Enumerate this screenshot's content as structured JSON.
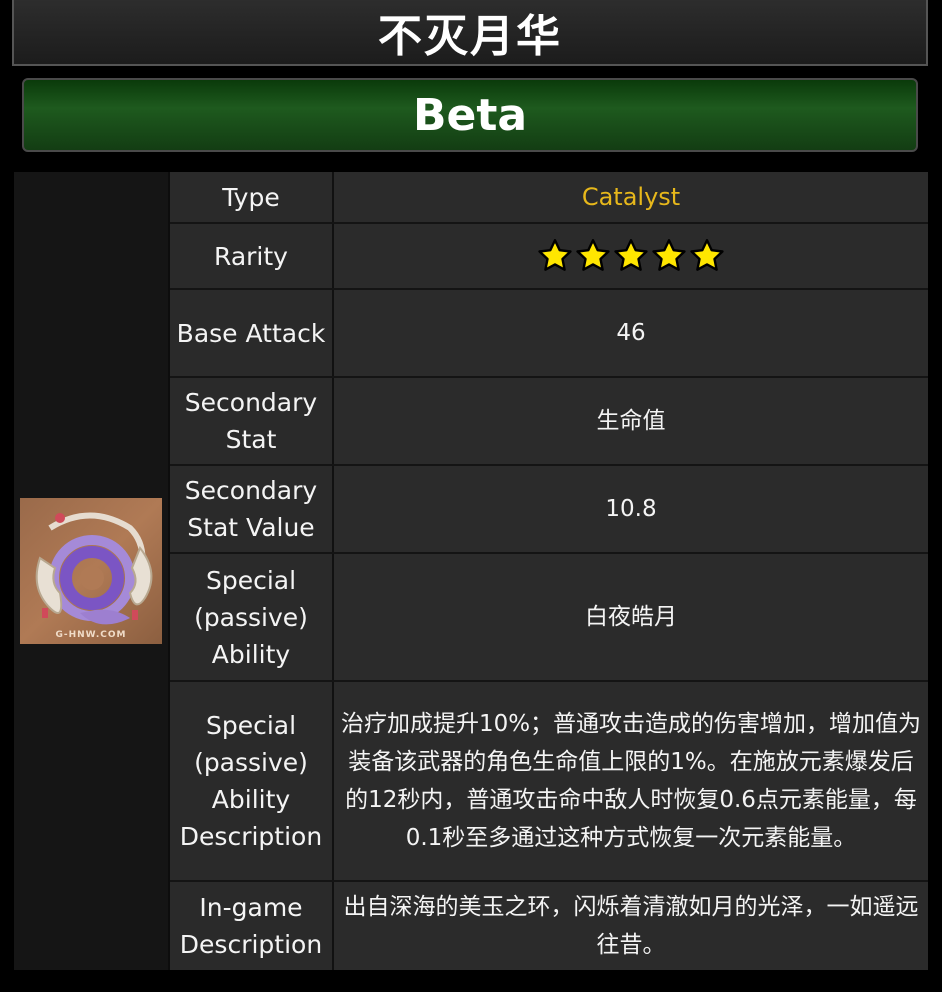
{
  "header": {
    "title": "不灭月华",
    "subtitle": "Beta"
  },
  "weapon_image": {
    "icon": "weapon-catalyst-icon",
    "watermark": "G-HNW.COM"
  },
  "rows": {
    "type": {
      "label": "Type",
      "value": "Catalyst",
      "value_color": "#e7b81b"
    },
    "rarity": {
      "label": "Rarity",
      "stars": 5,
      "star_color": "#ffe600"
    },
    "base_attack": {
      "label": "Base Attack",
      "value": "46"
    },
    "secondary_stat": {
      "label": "Secondary Stat",
      "value": "生命值"
    },
    "secondary_stat_value": {
      "label": "Secondary Stat Value",
      "value": "10.8"
    },
    "special_ability": {
      "label": "Special (passive) Ability",
      "value": "白夜皓月"
    },
    "special_ability_description": {
      "label": "Special (passive) Ability Description",
      "value": "治疗加成提升10%；普通攻击造成的伤害增加，增加值为装备该武器的角色生命值上限的1%。在施放元素爆发后的12秒内，普通攻击命中敌人时恢复0.6点元素能量，每0.1秒至多通过这种方式恢复一次元素能量。"
    },
    "ingame_description": {
      "label": "In-game Description",
      "value": "出自深海的美玉之环，闪烁着清澈如月的光泽，一如遥远往昔。"
    }
  }
}
